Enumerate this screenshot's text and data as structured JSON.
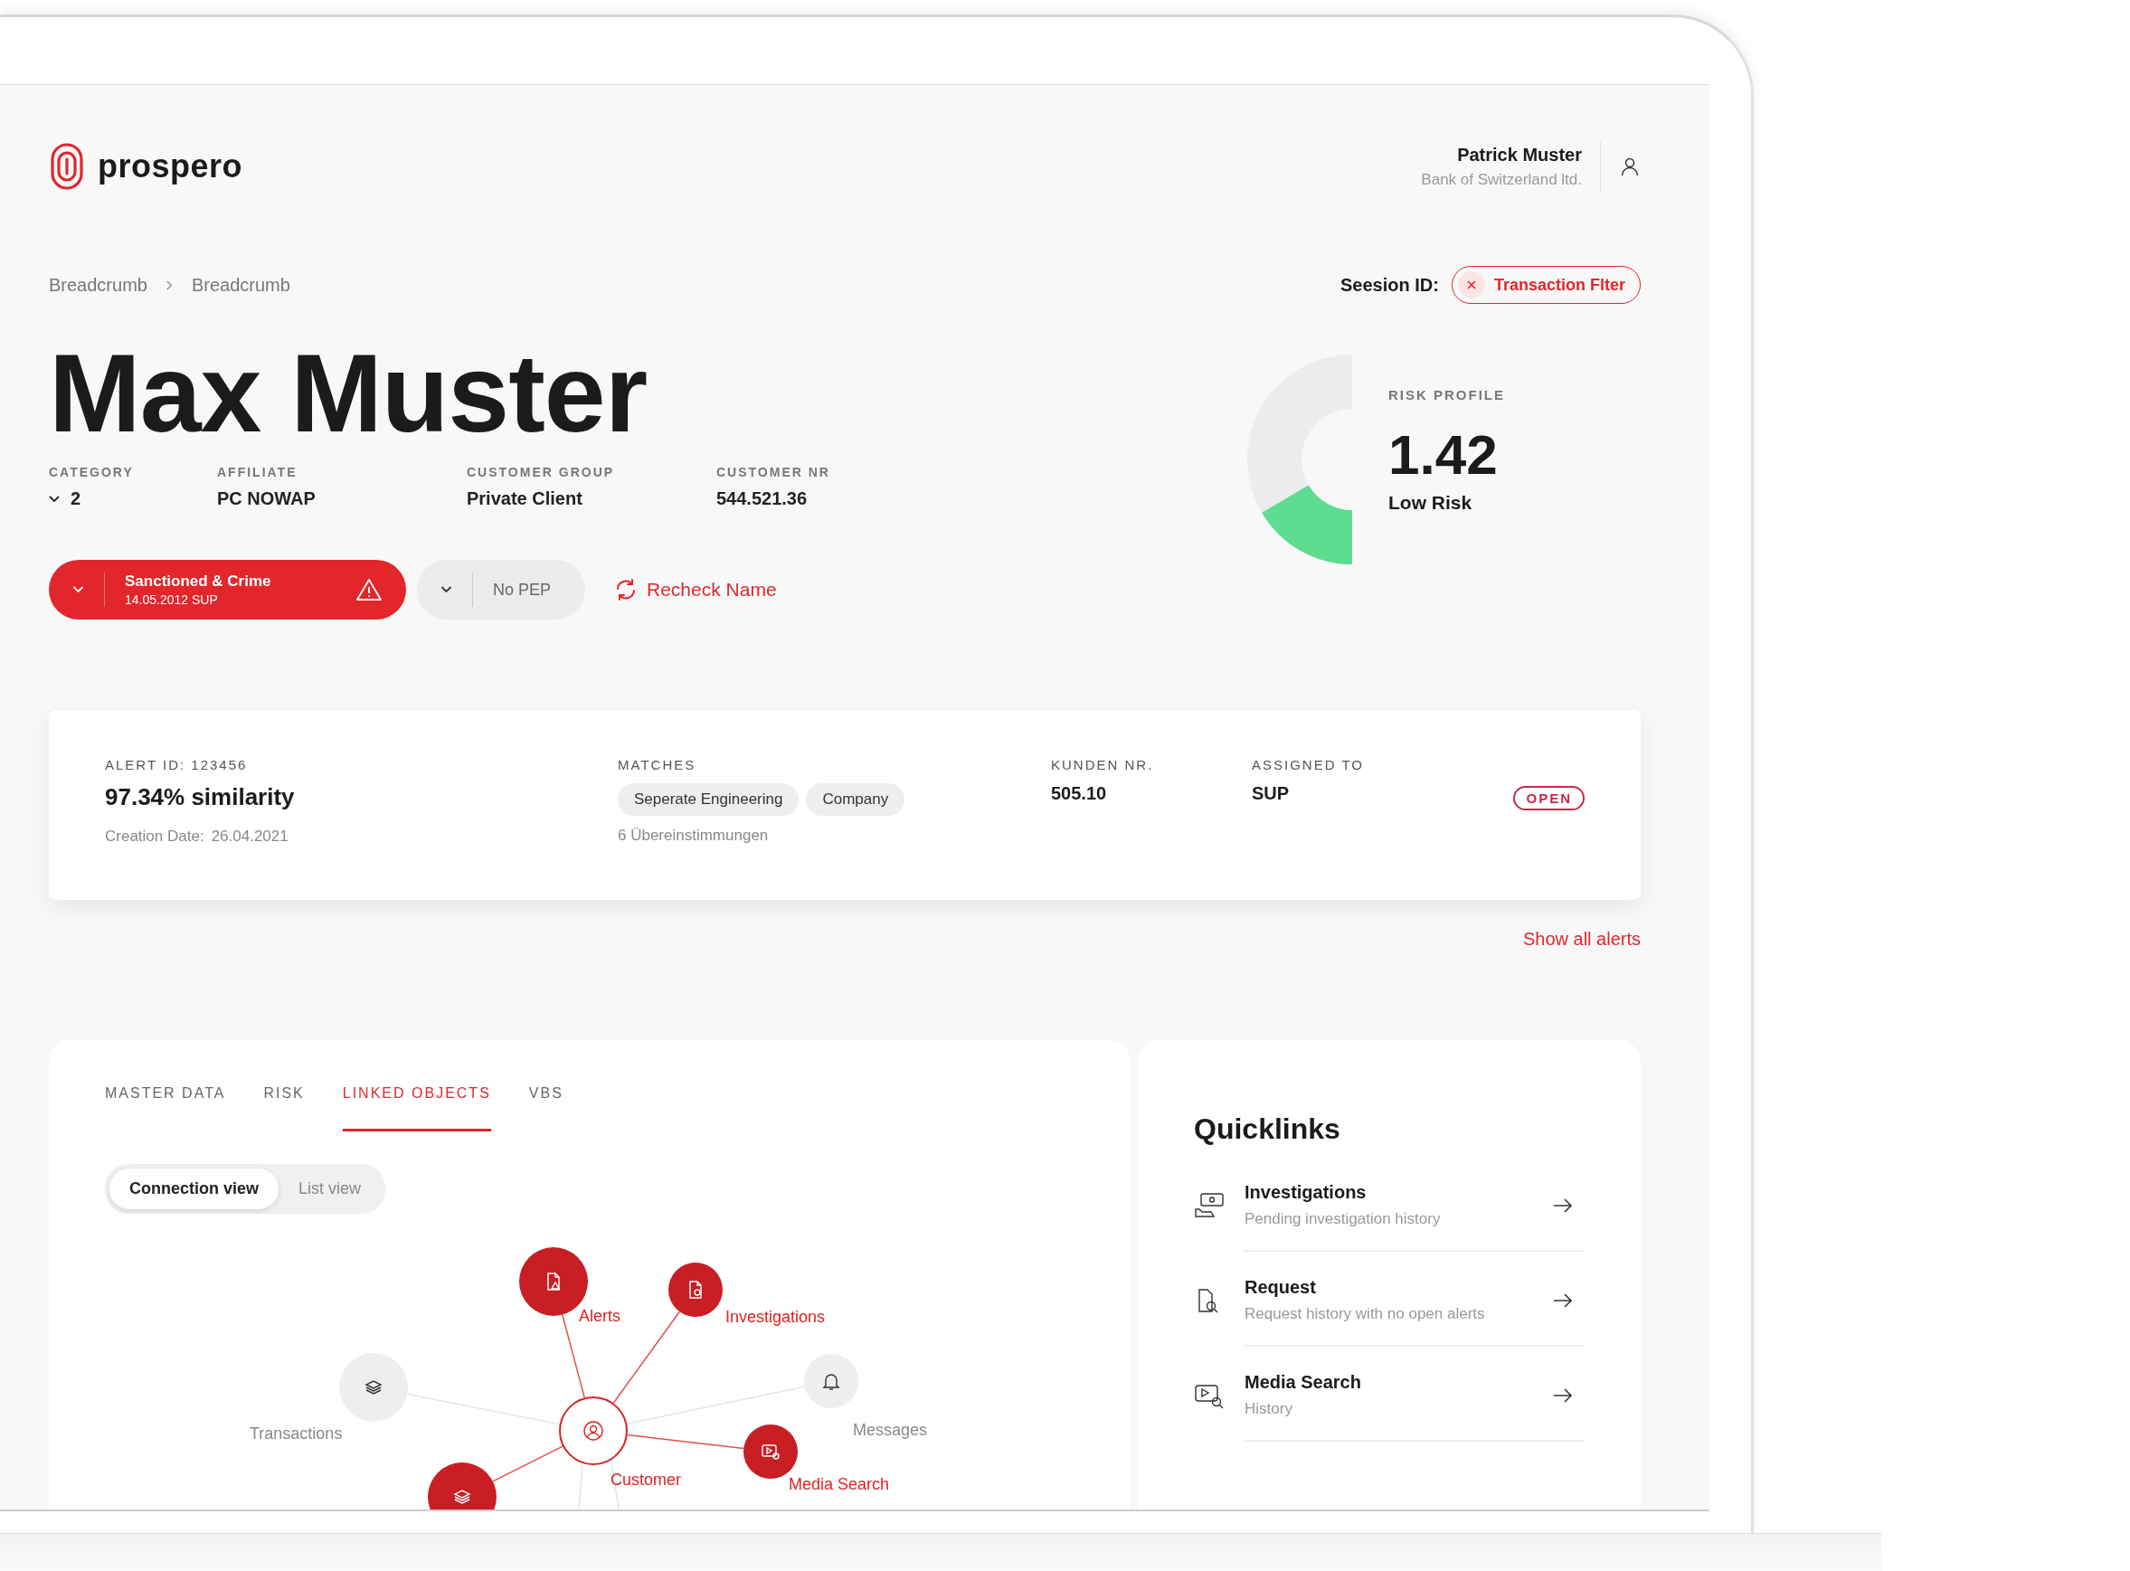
{
  "brand": {
    "name": "prospero"
  },
  "user": {
    "name": "Patrick Muster",
    "organization": "Bank of Switzerland ltd."
  },
  "breadcrumbs": [
    "Breadcrumb",
    "Breadcrumb"
  ],
  "session": {
    "label": "Seesion ID:",
    "filter_chip": "Transaction Flter"
  },
  "customer": {
    "name": "Max Muster",
    "fields": [
      {
        "label": "CATEGORY",
        "value": "2",
        "kind": "dropdown"
      },
      {
        "label": "AFFILIATE",
        "value": "PC NOWAP",
        "kind": "text"
      },
      {
        "label": "CUSTOMER GROUP",
        "value": "Private Client",
        "kind": "text"
      },
      {
        "label": "CUSTOMER NR",
        "value": "544.521.36",
        "kind": "text"
      }
    ]
  },
  "status_buttons": [
    {
      "kind": "alert",
      "title": "Sanctioned & Crime",
      "subtitle": "14.05.2012 SUP"
    },
    {
      "kind": "neutral",
      "title": "No PEP"
    }
  ],
  "recheck_link": "Recheck Name",
  "risk_profile": {
    "label": "RISK PROFILE",
    "score": "1.42",
    "rating": "Low Risk",
    "level": 0.33
  },
  "alert_card": {
    "alert_id": "ALERT ID: 123456",
    "similarity": "97.34% similarity",
    "creation_label": "Creation Date:",
    "creation_date": "26.04.2021",
    "matches_label": "MATCHES",
    "matches": [
      "Seperate Engineering",
      "Company"
    ],
    "matches_count": "6 Übereinstimmungen",
    "kunden_label": "KUNDEN NR.",
    "kunden_value": "505.10",
    "assigned_label": "ASSIGNED TO",
    "assigned_value": "SUP",
    "status": "OPEN"
  },
  "show_all_alerts": "Show all alerts",
  "tabs": [
    {
      "label": "MASTER DATA",
      "selected": false
    },
    {
      "label": "RISK",
      "selected": false
    },
    {
      "label": "LINKED OBJECTS",
      "selected": true
    },
    {
      "label": "VBS",
      "selected": false
    }
  ],
  "view_toggle": [
    {
      "label": "Connection view",
      "selected": true
    },
    {
      "label": "List view",
      "selected": false
    }
  ],
  "graph_nodes": [
    {
      "kind": "alerts",
      "label": "Alerts",
      "active": true
    },
    {
      "kind": "investigations",
      "label": "Investigations",
      "active": true
    },
    {
      "kind": "messages",
      "label": "Messages",
      "active": false
    },
    {
      "kind": "media",
      "label": "Media Search",
      "active": true
    },
    {
      "kind": "customer",
      "label": "Customer",
      "active": true
    },
    {
      "kind": "transactions",
      "label": "Transactions",
      "active": false
    },
    {
      "kind": "transfers",
      "active": true
    }
  ],
  "quicklinks": {
    "title": "Quicklinks",
    "items": [
      {
        "kind": "money",
        "title": "Investigations",
        "subtitle": "Pending investigation history"
      },
      {
        "kind": "document",
        "title": "Request",
        "subtitle": "Request history with no open alerts"
      },
      {
        "kind": "media",
        "title": "Media Search",
        "subtitle": "History"
      }
    ]
  }
}
